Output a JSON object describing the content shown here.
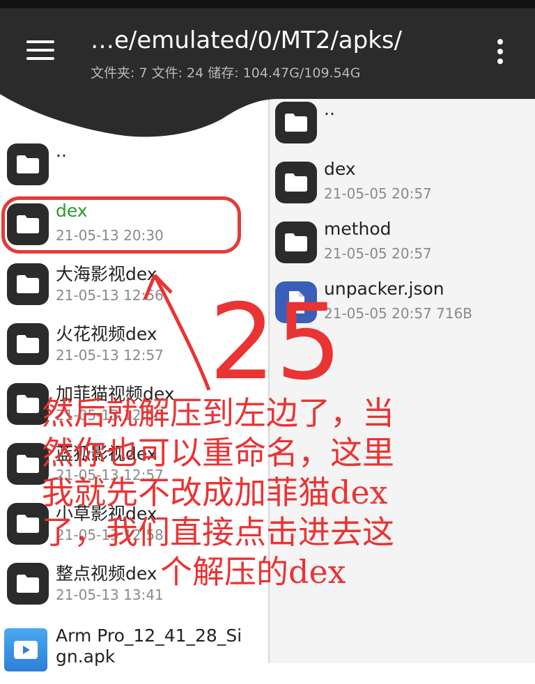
{
  "header": {
    "path": "…e/emulated/0/MT2/apks/",
    "stats": "文件夹: 7  文件: 24  储存: 104.47G/109.54G"
  },
  "left_pane": {
    "items": [
      {
        "name": "..",
        "meta": "",
        "type": "folder"
      },
      {
        "name": "dex",
        "meta": "21-05-13 20:30",
        "type": "folder"
      },
      {
        "name": "大海影视dex",
        "meta": "21-05-13 12:56",
        "type": "folder"
      },
      {
        "name": "火花视频dex",
        "meta": "21-05-13 12:57",
        "type": "folder"
      },
      {
        "name": "加菲猫视频dex",
        "meta": "21-05-13 12:50",
        "type": "folder"
      },
      {
        "name": "蓝狐影视dex",
        "meta": "21-05-13 12:57",
        "type": "folder"
      },
      {
        "name": "小草影视dex",
        "meta": "21-05-13 12:58",
        "type": "folder"
      },
      {
        "name": "整点视频dex",
        "meta": "21-05-13 13:41",
        "type": "folder"
      },
      {
        "name": "Arm Pro_12_41_28_Si",
        "name2": "gn.apk",
        "meta": "",
        "type": "apk"
      }
    ]
  },
  "right_pane": {
    "items": [
      {
        "name": "..",
        "meta": "",
        "type": "folder"
      },
      {
        "name": "dex",
        "meta": "21-05-05 20:57",
        "type": "folder"
      },
      {
        "name": "method",
        "meta": "21-05-05 20:57",
        "type": "folder"
      },
      {
        "name": "unpacker.json",
        "meta": "21-05-05 20:57  716B",
        "type": "json"
      }
    ]
  },
  "annotation": {
    "number": "25",
    "lines": [
      "然后就解压到左边了，当",
      "然你也可以重命名，这里",
      "我就先不改成加菲猫dex",
      "了，我们直接点击进去这",
      "个解压的dex"
    ],
    "color": "#ea3333"
  },
  "colors": {
    "selected_name": "#2a9a2a",
    "header_bg": "#2b2b2b"
  }
}
